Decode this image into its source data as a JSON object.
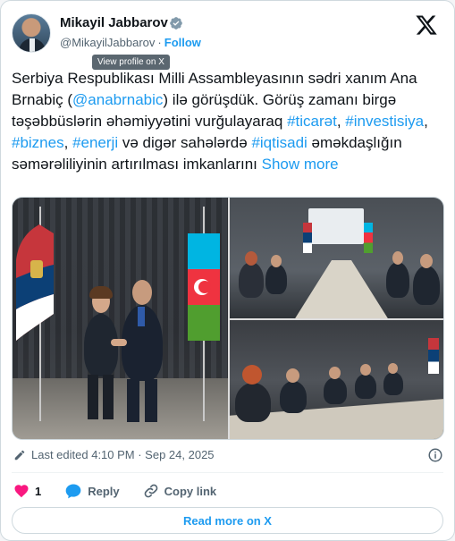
{
  "author": {
    "name": "Mikayil Jabbarov",
    "handle": "@MikayilJabbarov",
    "separator": "·",
    "follow_label": "Follow"
  },
  "tooltip": "View profile on X",
  "tweet": {
    "text_before_mention": "Serbiya Respublikası Milli Assambleyasının sədri xanım Ana Brnabiç (",
    "mention": "@anabrnabic",
    "text_after_mention": ") ilə görüşdük. Görüş zamanı birgə təşəbbüslərin əhəmiyyətini vurğulayaraq ",
    "hashtag_1": "#ticarət",
    "comma_1": ", ",
    "hashtag_2": "#investisiya",
    "comma_2": ", ",
    "hashtag_3": "#biznes",
    "comma_3": ", ",
    "hashtag_4": "#enerji",
    "text_middle": " və digər sahələrdə ",
    "hashtag_5": "#iqtisadi",
    "text_end": " əməkdaşlığın səmərəliliyinin artırılması imkanlarını ",
    "show_more": "Show more"
  },
  "photos": {
    "icons": [
      "flag-serbia",
      "flag-azerbaijan",
      "meeting-table"
    ]
  },
  "meta": {
    "edited_label": "Last edited 4:10 PM · Sep 24, 2025"
  },
  "actions": {
    "like_count": "1",
    "reply_label": "Reply",
    "copy_link_label": "Copy link"
  },
  "read_more_label": "Read more on X",
  "colors": {
    "accent": "#1d9bf0",
    "like": "#f91880",
    "text": "#0f1419",
    "muted": "#536471"
  }
}
